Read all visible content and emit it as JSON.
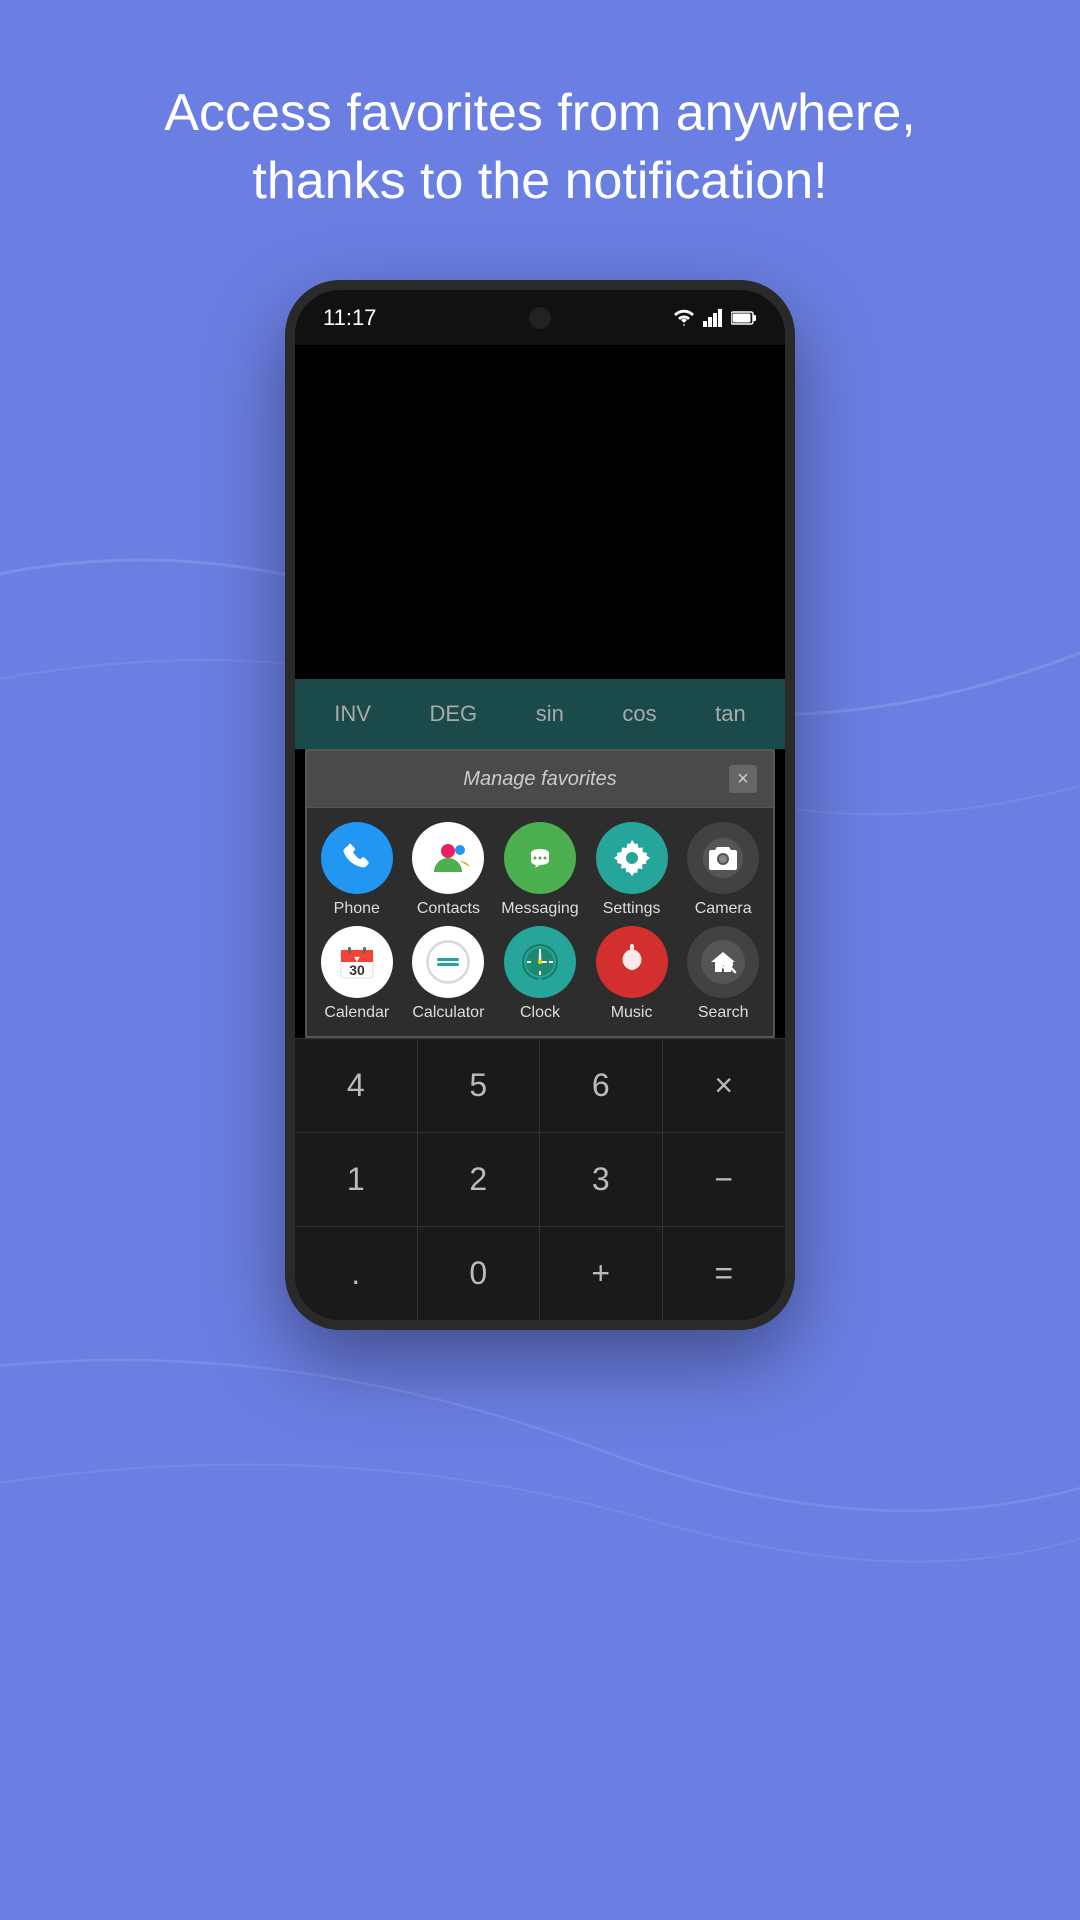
{
  "page": {
    "background_color": "#6b7fe3",
    "hero_text_line1": "Access favorites from anywhere,",
    "hero_text_line2": "thanks to the notification!"
  },
  "status_bar": {
    "time": "11:17",
    "wifi": "▼",
    "signal": "▲",
    "battery": "▮"
  },
  "calculator": {
    "header_buttons": [
      "INV",
      "DEG",
      "sin",
      "cos",
      "tan"
    ],
    "rows": [
      [
        "4",
        "5",
        "6",
        "×"
      ],
      [
        "1",
        "2",
        "3",
        "−"
      ],
      [
        ".",
        "0",
        "+",
        "="
      ]
    ]
  },
  "favorites_dialog": {
    "title": "Manage favorites",
    "close_label": "×",
    "apps": [
      {
        "name": "Phone",
        "icon_type": "phone",
        "icon_emoji": "📞"
      },
      {
        "name": "Contacts",
        "icon_type": "contacts",
        "icon_emoji": "👥"
      },
      {
        "name": "Messaging",
        "icon_type": "messaging",
        "icon_emoji": "💬"
      },
      {
        "name": "Settings",
        "icon_type": "settings",
        "icon_emoji": "⚙️"
      },
      {
        "name": "Camera",
        "icon_type": "camera",
        "icon_emoji": "📷"
      },
      {
        "name": "Calendar",
        "icon_type": "calendar",
        "icon_emoji": "📅"
      },
      {
        "name": "Calculator",
        "icon_type": "calculator",
        "icon_emoji": "🧮"
      },
      {
        "name": "Clock",
        "icon_type": "clock",
        "icon_emoji": "🕐"
      },
      {
        "name": "Music",
        "icon_type": "music",
        "icon_emoji": "🎵"
      },
      {
        "name": "Search",
        "icon_type": "search",
        "icon_emoji": "🔍"
      }
    ]
  }
}
